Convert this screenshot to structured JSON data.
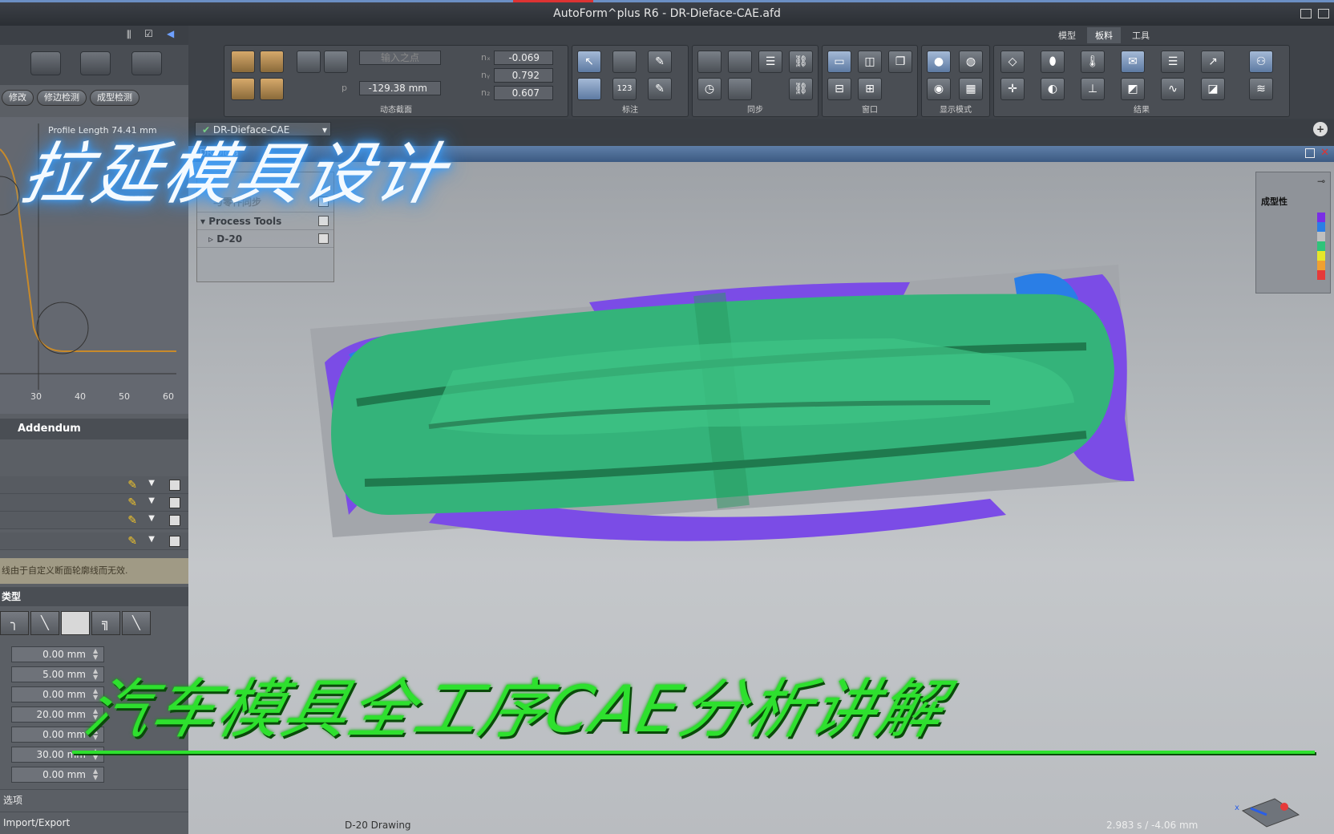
{
  "window": {
    "title": "AutoForm^plus R6 - DR-Dieface-CAE.afd"
  },
  "left_panel": {
    "buttons": [
      "修改",
      "修边检测",
      "成型检测"
    ],
    "profile_length": "Profile Length 74.41 mm",
    "axis_ticks": [
      "30",
      "40",
      "50",
      "60"
    ],
    "section_title": "Addendum",
    "warning_note": "线由于自定义断面轮廓线而无效.",
    "type_header": "类型",
    "type_buttons": [
      "╮",
      "╲",
      "",
      "╗",
      "╲"
    ],
    "fields": [
      "0.00 mm",
      "5.00 mm",
      "0.00 mm",
      "20.00 mm",
      "0.00 mm",
      "30.00 mm",
      "0.00 mm"
    ],
    "options_label": "选项",
    "import_export": "Import/Export"
  },
  "ribbon": {
    "tabs": [
      "模型",
      "板料",
      "工具"
    ],
    "active_tab": "板料",
    "nx": "-0.069",
    "ny": "0.792",
    "nz": "0.607",
    "p_label": "p",
    "p_value": "-129.38 mm",
    "input_placeholder": "输入之点",
    "groups": [
      "动态截面",
      "标注",
      "同步",
      "窗口",
      "显示模式",
      "结果"
    ]
  },
  "document": {
    "tab_label": "DR-Dieface-CAE",
    "view_title": "DR-Diefa"
  },
  "tree": {
    "items": [
      {
        "label": "与零件同步"
      },
      {
        "label": "Process Tools"
      },
      {
        "label": "D-20"
      }
    ]
  },
  "legend": {
    "title": "成型性",
    "colors": [
      "#7a2ee6",
      "#2a7ee6",
      "#bfbfbf",
      "#2fc37a",
      "#e6e62a",
      "#f0a030",
      "#e63a3a"
    ]
  },
  "status": {
    "drawing_name": "D-20 Drawing",
    "time": "2.983 s / -4.06 mm"
  },
  "overlay": {
    "top_text": "拉延模具设计",
    "bottom_text": "汽车模具全工序CAE分析讲解"
  }
}
